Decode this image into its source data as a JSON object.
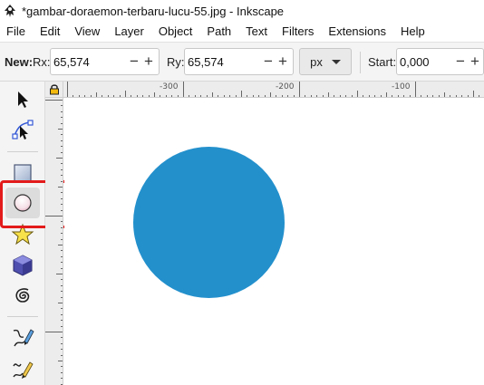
{
  "window": {
    "title": "*gambar-doraemon-terbaru-lucu-55.jpg - Inkscape"
  },
  "menu": [
    "File",
    "Edit",
    "View",
    "Layer",
    "Object",
    "Path",
    "Text",
    "Filters",
    "Extensions",
    "Help"
  ],
  "tool_controls": {
    "new_label": "New:",
    "rx_label": "Rx:",
    "rx_value": "65,574",
    "ry_label": "Ry:",
    "ry_value": "65,574",
    "unit": "px",
    "start_label": "Start:",
    "start_value": "0,000",
    "minus": "−",
    "plus": "+"
  },
  "toolbox": {
    "tools": [
      "selector-tool",
      "node-tool",
      "rectangle-tool",
      "ellipse-tool",
      "star-tool",
      "3d-box-tool",
      "spiral-tool",
      "pen-tool",
      "pencil-tool"
    ],
    "active": "ellipse-tool",
    "highlight_color": "#e31b1b"
  },
  "rulers": {
    "h_labels": [
      "-300",
      "-200",
      "-100"
    ]
  },
  "canvas": {
    "shape_fill": "#2390cc"
  }
}
